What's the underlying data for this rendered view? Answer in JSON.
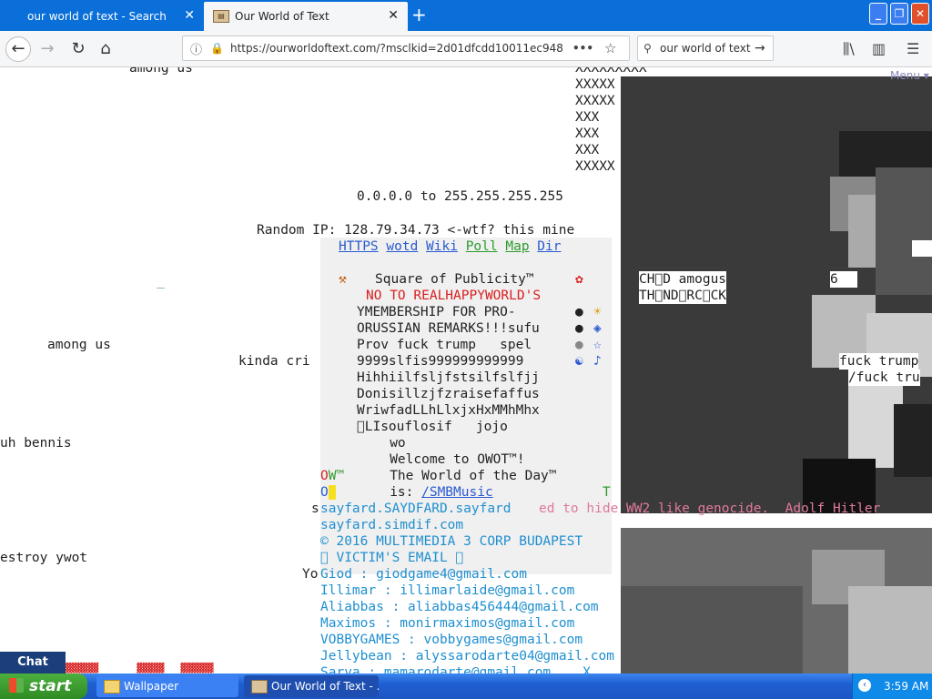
{
  "browser": {
    "tabs": [
      {
        "label": "our world of text - Search",
        "active": false
      },
      {
        "label": "Our World of Text",
        "active": true
      }
    ],
    "new_tab_label": "+",
    "url": "https://ourworldoftext.com/?msclkid=2d01dfcdd10011ec948",
    "search_value": "our world of text",
    "window_buttons": [
      "minimize",
      "maximize",
      "close"
    ]
  },
  "page": {
    "texts": {
      "among_us_top": "among us",
      "x1": "XXXXXXXXX",
      "x2": "XXXXX",
      "x3": "XXXXX",
      "x4": "XXX",
      "x5": "XXX",
      "x6": "XXX",
      "x7": "XXXXX",
      "ip_range": "0.0.0.0 to 255.255.255.255",
      "random_ip": "Random IP: 128.79.34.73 <-wtf? this mine",
      "underscore": "_",
      "among_us_left": "among us",
      "kinda": "kinda cri",
      "uh_bennis": "uh bennis",
      "destroy": "estroy ywot",
      "yo": "Yo",
      "s_char": "s",
      "chd_amogus": "CH\u0000D amogus",
      "thund": "TH\u0000ND\u0000RC\u0000CK",
      "six": "6",
      "fuck_trump1": "fuck trump",
      "fuck_trump2": "/fuck tru",
      "menu": "Menu ▾",
      "hitler": "ed to hide WW2 like genocide.  Adolf Hitler",
      "sayfard1": "sayfard.SAYDFARD.sayfard",
      "sayfard2": "sayfard.simdif.com",
      "copyright": "© 2016 MULTIMEDIA 3 CORP BUDAPEST",
      "victim": "\u0000 VICTIM'S EMAIL \u0000",
      "email1": "Giod : giodgame4@gmail.com",
      "email2": "Illimar : illimarlaide@gmail.com",
      "email3": "Aliabbas : aliabbas456444@gmail.com",
      "email4": "Maximos : monirmaximos@gmail.com",
      "email5": "VOBBYGAMES : vobbygames@gmail.com",
      "email6": "Jellybean : alyssarodarte04@gmail.com",
      "email7": "Sarva : mamarodarte@gmail.com    X"
    },
    "board": {
      "links": [
        "HTTPS",
        "wotd",
        "Wiki",
        "Poll",
        "Map",
        "Dir"
      ],
      "title": "Square of Publicity™",
      "lines": [
        "NO TO REALHAPPYWORLD'S",
        "YMEMBERSHIP FOR PRO-",
        "ORUSSIAN REMARKS!!!sufu",
        "Prov fuck trump   spel",
        "9999slfis999999999999",
        "Hihhiilfsljfstsilfslfjj",
        "Donisillzjfzraisefaffus",
        "WriwfadLLhLlxjxHxMMhMhx",
        "\u0000LIsouflosif   jojo",
        "   wo",
        "   Welcome to OWOT™!",
        "   The World of the Day™",
        "   is: "
      ],
      "ow_label": "OW™",
      "o_label": "O",
      "wotd_link": "/SMBMusic",
      "t_label": "T"
    },
    "chat_label": "Chat"
  },
  "taskbar": {
    "start_label": "start",
    "items": [
      {
        "label": "Wallpaper"
      },
      {
        "label": "Our World of Text - ..."
      }
    ],
    "clock": "3:59 AM"
  },
  "colors": {
    "tab_blue": "#0a6fd8",
    "link_blue": "#2a5ad0",
    "link_green": "#2e9a2e",
    "email_blue": "#1f8fd0",
    "pink": "#e07a9a",
    "red": "#d82020"
  }
}
